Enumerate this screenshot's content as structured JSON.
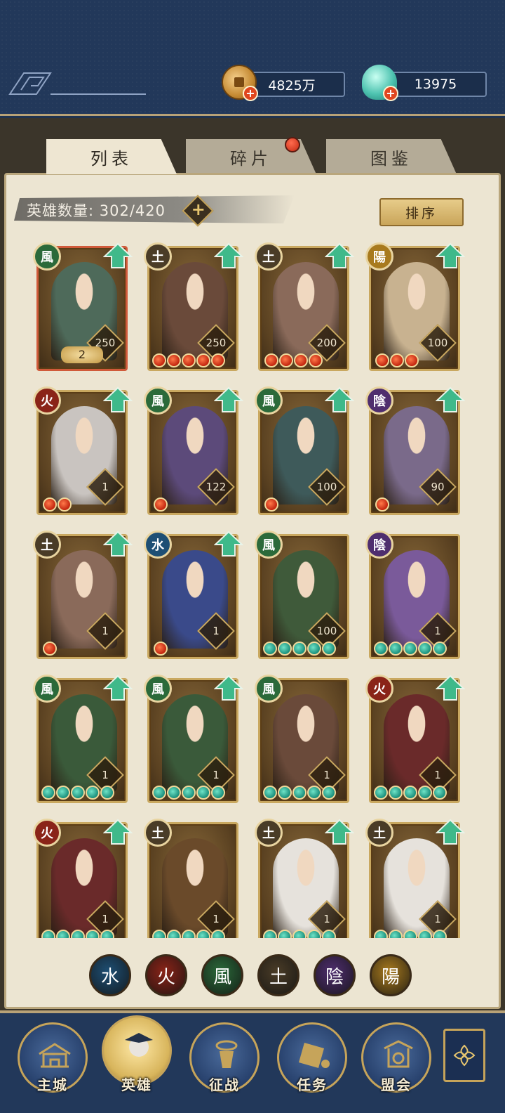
{
  "currency": {
    "coins": "4825万",
    "gems": "13975"
  },
  "tabs": [
    "列表",
    "碎片",
    "图鉴"
  ],
  "hero_count_label": "英雄数量: 302/420",
  "sort_label": "排序",
  "heroes": [
    {
      "element": "風",
      "level": "250",
      "stars": 0,
      "rank": "2",
      "upgrade": true
    },
    {
      "element": "土",
      "level": "250",
      "stars": 5,
      "upgrade": true
    },
    {
      "element": "土",
      "level": "200",
      "stars": 4,
      "upgrade": true
    },
    {
      "element": "陽",
      "level": "100",
      "stars": 3,
      "upgrade": true
    },
    {
      "element": "火",
      "level": "1",
      "stars": 2,
      "upgrade": true
    },
    {
      "element": "風",
      "level": "122",
      "stars": 1,
      "upgrade": true
    },
    {
      "element": "風",
      "level": "100",
      "stars": 1,
      "upgrade": true
    },
    {
      "element": "陰",
      "level": "90",
      "stars": 1,
      "upgrade": true
    },
    {
      "element": "土",
      "level": "1",
      "stars": 1,
      "upgrade": true
    },
    {
      "element": "水",
      "level": "1",
      "stars": 1,
      "upgrade": true
    },
    {
      "element": "風",
      "level": "100",
      "stars": 5,
      "upgrade": false
    },
    {
      "element": "陰",
      "level": "1",
      "stars": 5,
      "upgrade": false
    },
    {
      "element": "風",
      "level": "1",
      "stars": 5,
      "upgrade": true
    },
    {
      "element": "風",
      "level": "1",
      "stars": 5,
      "upgrade": true
    },
    {
      "element": "風",
      "level": "1",
      "stars": 5,
      "upgrade": false
    },
    {
      "element": "火",
      "level": "1",
      "stars": 5,
      "upgrade": true
    },
    {
      "element": "火",
      "level": "1",
      "stars": 5,
      "upgrade": true
    },
    {
      "element": "土",
      "level": "1",
      "stars": 5,
      "upgrade": false
    },
    {
      "element": "土",
      "level": "1",
      "stars": 5,
      "upgrade": true
    },
    {
      "element": "土",
      "level": "1",
      "stars": 5,
      "upgrade": true
    }
  ],
  "filters": [
    "水",
    "火",
    "風",
    "土",
    "陰",
    "陽"
  ],
  "nav": [
    "主城",
    "英雄",
    "征战",
    "任务",
    "盟会"
  ],
  "element_colors": {
    "水": "#1e4f74",
    "火": "#8a2418",
    "風": "#2b6a3a",
    "土": "#4a3c27",
    "陰": "#4f2e6e",
    "陽": "#a87a1e"
  }
}
